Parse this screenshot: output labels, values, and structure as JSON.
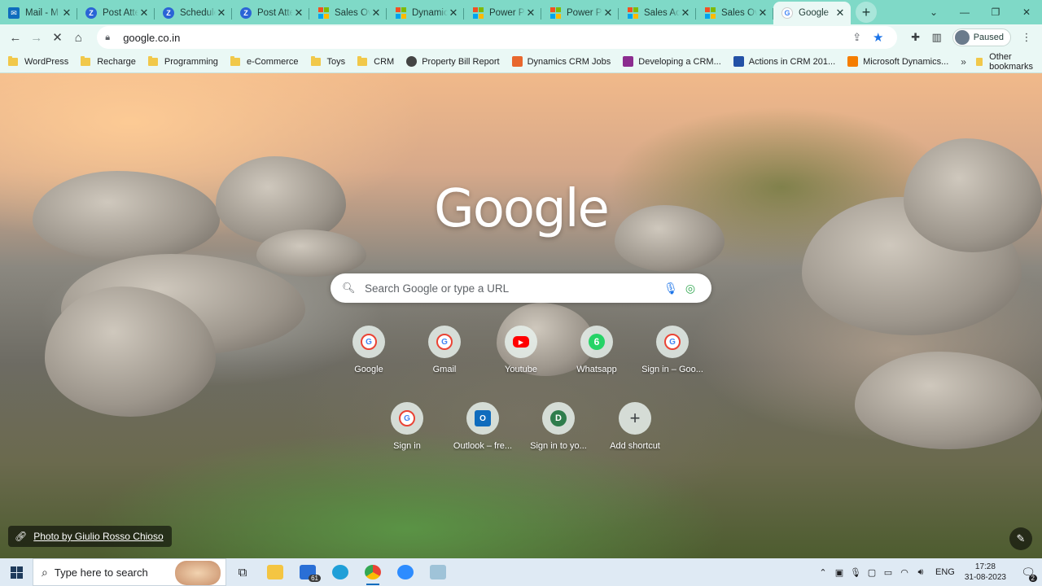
{
  "tabs": [
    {
      "title": "Mail - M",
      "favicon": "outlook-icon"
    },
    {
      "title": "Post Atte",
      "favicon": "zoho-icon"
    },
    {
      "title": "Schedule",
      "favicon": "zoho-icon"
    },
    {
      "title": "Post Atte",
      "favicon": "zoho-icon"
    },
    {
      "title": "Sales Ov",
      "favicon": "microsoft-icon"
    },
    {
      "title": "Dynamics",
      "favicon": "microsoft-icon"
    },
    {
      "title": "Power Pl",
      "favicon": "microsoft-icon"
    },
    {
      "title": "Power Pl",
      "favicon": "microsoft-icon"
    },
    {
      "title": "Sales Act",
      "favicon": "microsoft-icon"
    },
    {
      "title": "Sales Ov",
      "favicon": "microsoft-icon"
    },
    {
      "title": "Google",
      "favicon": "google-icon",
      "active": true
    }
  ],
  "toolbar": {
    "url": "google.co.in",
    "profile_status": "Paused"
  },
  "bookmarks": [
    {
      "label": "WordPress",
      "type": "folder"
    },
    {
      "label": "Recharge",
      "type": "folder"
    },
    {
      "label": "Programming",
      "type": "folder"
    },
    {
      "label": "e-Commerce",
      "type": "folder"
    },
    {
      "label": "Toys",
      "type": "folder"
    },
    {
      "label": "CRM",
      "type": "folder"
    },
    {
      "label": "Property Bill Report",
      "type": "globe"
    },
    {
      "label": "Dynamics CRM Jobs",
      "type": "dyn"
    },
    {
      "label": "Developing a CRM...",
      "type": "dev"
    },
    {
      "label": "Actions in CRM 201...",
      "type": "act"
    },
    {
      "label": "Microsoft Dynamics...",
      "type": "blog"
    }
  ],
  "bookmarks_other": "Other bookmarks",
  "newtab": {
    "logo": "Google",
    "search_placeholder": "Search Google or type a URL",
    "shortcuts": [
      {
        "label": "Google",
        "icon": "google-icon",
        "letter": "G"
      },
      {
        "label": "Gmail",
        "icon": "google-icon",
        "letter": "G"
      },
      {
        "label": "Youtube",
        "icon": "youtube-icon",
        "letter": "▶"
      },
      {
        "label": "Whatsapp",
        "icon": "whatsapp-icon",
        "letter": "6"
      },
      {
        "label": "Sign in – Goo...",
        "icon": "google-icon",
        "letter": "G"
      },
      {
        "label": "Sign in",
        "icon": "google-icon",
        "letter": "G"
      },
      {
        "label": "Outlook – fre...",
        "icon": "outlook-icon",
        "letter": "O"
      },
      {
        "label": "Sign in to yo...",
        "icon": "d-icon",
        "letter": "D"
      },
      {
        "label": "Add shortcut",
        "icon": "plus-icon",
        "letter": "+"
      }
    ],
    "attribution": "Photo by Giulio Rosso Chioso"
  },
  "taskbar": {
    "search_placeholder": "Type here to search",
    "mail_badge": "61",
    "language": "ENG",
    "time": "17:28",
    "date": "31-08-2023",
    "notifications": "2"
  },
  "colors": {
    "tabstrip": "#7fd9c7",
    "toolbar": "#eaf8f5",
    "accent": "#1a73e8"
  }
}
